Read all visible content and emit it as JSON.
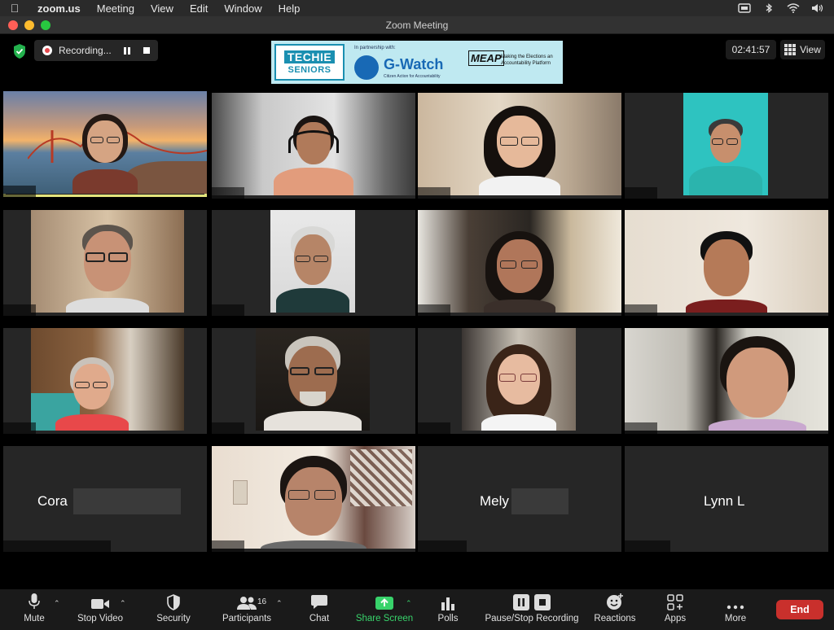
{
  "menubar": {
    "app": "zoom.us",
    "items": [
      "Meeting",
      "View",
      "Edit",
      "Window",
      "Help"
    ]
  },
  "window": {
    "title": "Zoom Meeting"
  },
  "recording": {
    "label": "Recording..."
  },
  "banner": {
    "techie_line1": "TECHIE",
    "techie_line2": "SENIORS",
    "partner_text": "In partnership with:",
    "gwatch": "G-Watch",
    "gwatch_sub": "Citizen Action for Accountability",
    "meap": "MEAP",
    "meap_sub": "Making the Elections an Accountability Platform"
  },
  "timer": "02:41:57",
  "view_label": "View",
  "tiles": [
    {
      "name": ""
    },
    {
      "name": ""
    },
    {
      "name": ""
    },
    {
      "name": ""
    },
    {
      "name": ""
    },
    {
      "name": ""
    },
    {
      "name": ""
    },
    {
      "name": ""
    },
    {
      "name": ""
    },
    {
      "name": ""
    },
    {
      "name": ""
    },
    {
      "name": ""
    },
    {
      "name": "Cora"
    },
    {
      "name": ""
    },
    {
      "name": "Mely"
    },
    {
      "name": "Lynn L"
    }
  ],
  "toolbar": {
    "mute": "Mute",
    "stop_video": "Stop Video",
    "security": "Security",
    "participants": "Participants",
    "participants_count": "16",
    "chat": "Chat",
    "share_screen": "Share Screen",
    "polls": "Polls",
    "pause_stop_recording": "Pause/Stop Recording",
    "reactions": "Reactions",
    "apps": "Apps",
    "more": "More",
    "end": "End"
  },
  "colors": {
    "active_speaker_border": "#e3e47c",
    "share_green": "#38d36b",
    "end_red": "#c9302c"
  }
}
